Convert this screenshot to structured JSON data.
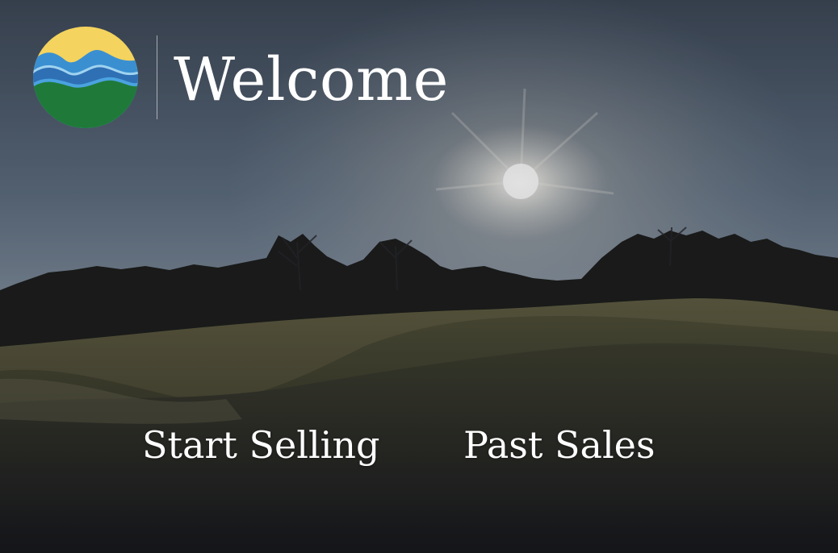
{
  "header": {
    "logo_icon": "mountain-water-logo-icon",
    "title": "Welcome"
  },
  "actions": {
    "start_selling_label": "Start Selling",
    "past_sales_label": "Past Sales"
  },
  "colors": {
    "logo_sun_yellow": "#f4d35e",
    "logo_water_blue": "#3a8fd1",
    "logo_land_green": "#1f7a3a",
    "text": "#ffffff"
  }
}
